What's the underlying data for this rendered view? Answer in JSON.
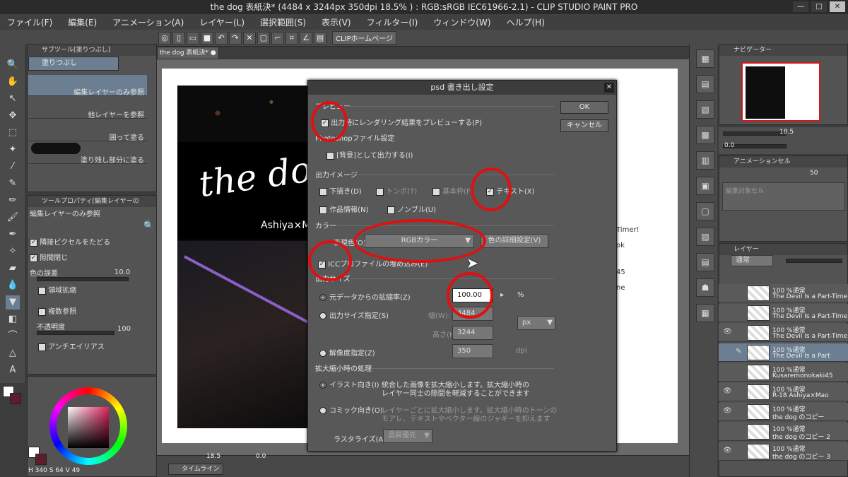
{
  "window": {
    "title": "the dog 表紙決* (4484 x 3244px 350dpi 18.5% ) : RGB:sRGB IEC61966-2.1) - CLIP STUDIO PAINT PRO",
    "minimize": "—",
    "maximize": "□",
    "close": "✕"
  },
  "menu": [
    "ファイル(F)",
    "編集(E)",
    "アニメーション(A)",
    "レイヤー(L)",
    "選択範囲(S)",
    "表示(V)",
    "フィルター(I)",
    "ウィンドウ(W)",
    "ヘルプ(H)"
  ],
  "toolbar": {
    "clip_home": "CLIPホームページ"
  },
  "document_tab": {
    "label": "the dog 表紙決*"
  },
  "subtool_panel": {
    "title": "サブツール[塗りつぶし]",
    "header": "塗りつぶし",
    "items": [
      "編集レイヤーのみ参照",
      "他レイヤーを参照",
      "囲って塗る",
      "塗り残し部分に塗る"
    ]
  },
  "tool_property": {
    "title": "ツールプロパティ[編集レイヤーの",
    "name": "編集レイヤーのみ参照",
    "adjacent": "隣接ピクセルをたどる",
    "close_gap": "隙間閉じ",
    "color_margin": "色の誤差",
    "color_margin_value": "10.0",
    "area_scaling": "領域拡縮",
    "multi_ref": "複数参照",
    "opacity": "不透明度",
    "opacity_value": "100",
    "antialias": "アンチエイリアス"
  },
  "color": {
    "h": "340",
    "s": "64",
    "v": "49",
    "h_label": "H",
    "s_label": "S",
    "v_label": "V",
    "main": "#5c1e2d"
  },
  "artwork": {
    "title": "the dog",
    "subtitle": "Ashiya×M"
  },
  "canvas_text": [
    "Timer!",
    "ok",
    "45",
    "ne"
  ],
  "dialog": {
    "title": "psd 書き出し設定",
    "ok": "OK",
    "cancel": "キャンセル",
    "preview_section": "プレビュー",
    "preview_option": "出力時にレンダリング結果をプレビューする(P)",
    "photoshop_section": "Photoshopファイル設定",
    "background_option": "[背景]として出力する(I)",
    "output_image_section": "出力イメージ",
    "draft": "下描き(D)",
    "tombo": "トンボ(T)",
    "basic_frame": "基本枠(F)",
    "text": "テキスト(X)",
    "work_info": "作品情報(N)",
    "nonble": "ノンブル(U)",
    "color_section": "カラー",
    "color_expression_label": "表現色(O)",
    "color_expression_value": "RGBカラー",
    "color_detail_button": "色の詳細設定(V)",
    "icc_option": "ICCプロファイルの埋め込み(E)",
    "output_size_section": "出力サイズ",
    "scale_option": "元データからの拡縮率(Z)",
    "scale_value": "100.00",
    "scale_unit": "%",
    "size_option": "出力サイズ指定(S)",
    "width_label": "幅(W):",
    "width_value": "4484",
    "height_label": "高さ(H):",
    "height_value": "3244",
    "unit_value": "px",
    "resolution_option": "解像度指定(Z)",
    "resolution_value": "350",
    "resolution_unit": "dpi",
    "scaling_section": "拡大縮小時の処理",
    "illust_option": "イラスト向き(I)",
    "illust_desc_1": "統合した画像を拡大縮小します。拡大縮小時の",
    "illust_desc_2": "レイヤー同士の隙間を軽減することができます",
    "comic_option": "コミック向き(O)",
    "comic_desc_1": "レイヤーごとに拡大縮小します。拡大縮小時のトーンの",
    "comic_desc_2": "モアレ、テキストやベクター線のジャギーを抑えます",
    "rasterize_label": "ラスタライズ(A):",
    "rasterize_value": "品質優先"
  },
  "navigator": {
    "title": "ナビゲーター",
    "zoom": "18.5",
    "angle": "0.0"
  },
  "animation_cel": {
    "title": "アニメーションセル",
    "value": "50",
    "placeholder": "編集対象セル"
  },
  "layer_panel": {
    "title": "レイヤー",
    "blend": "通常",
    "layers": [
      {
        "pct": "100 %通常",
        "name": "The Devil Is a Part-Timer!"
      },
      {
        "pct": "100 %通常",
        "name": "The Devil Is a Part-Timer"
      },
      {
        "pct": "100 %通常",
        "name": "The Devil Is a Part-Timer"
      },
      {
        "pct": "100 %通常",
        "name": "The Devil Is a Part"
      },
      {
        "pct": "100 %通常",
        "name": "Kusaremonokaki45"
      },
      {
        "pct": "100 %通常",
        "name": "R-18 Ashiya×Mao"
      },
      {
        "pct": "100 %通常",
        "name": "the dog のコピー"
      },
      {
        "pct": "100 %通常",
        "name": "the dog のコピー 2"
      },
      {
        "pct": "100 %通常",
        "name": "the dog のコピー 3"
      }
    ]
  },
  "statusbar": {
    "zoom": "18.5",
    "angle": "0.0",
    "timeline": "タイムライン"
  }
}
